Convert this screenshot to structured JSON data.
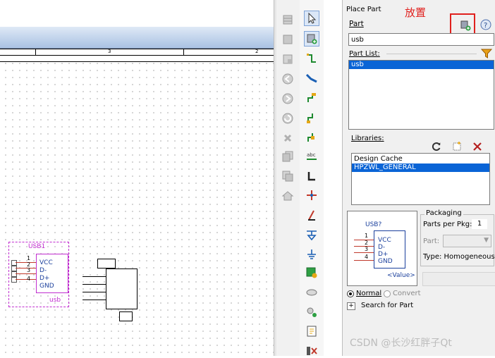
{
  "annotation": {
    "text": "放置"
  },
  "panel": {
    "title": "Place Part",
    "part_label": "Part",
    "part_value": "usb",
    "part_list_label": "Part List:",
    "part_list_items": [
      "usb"
    ],
    "libraries_label": "Libraries:",
    "libraries": [
      "Design Cache",
      "HPZWL_GENERAL"
    ],
    "packaging_label": "Packaging",
    "parts_per_pkg_label": "Parts per Pkg:",
    "parts_per_pkg_value": "1",
    "part_label2": "Part:",
    "type_text": "Type: Homogeneous",
    "normal_label": "Normal",
    "convert_label": "Convert",
    "search_label": "Search for Part",
    "search_plus": "+"
  },
  "preview": {
    "refdes": "USB?",
    "pins": [
      "1",
      "2",
      "3",
      "4"
    ],
    "pin_names": [
      "VCC",
      "D-",
      "D+",
      "GND"
    ],
    "value": "<Value>"
  },
  "schematic": {
    "ruler": [
      "3",
      "2"
    ],
    "part_ref": "USB1",
    "pins": [
      "1",
      "2",
      "3",
      "4"
    ],
    "pin_names": [
      "VCC",
      "D-",
      "D+",
      "GND"
    ],
    "part_value": "usb"
  },
  "watermark": "CSDN @长沙红胖子Qt",
  "colors": {
    "selection": "#0a64d6",
    "part_outline": "#c02ccf",
    "pin_line": "#c0392b",
    "annotation": "#e0201d"
  }
}
